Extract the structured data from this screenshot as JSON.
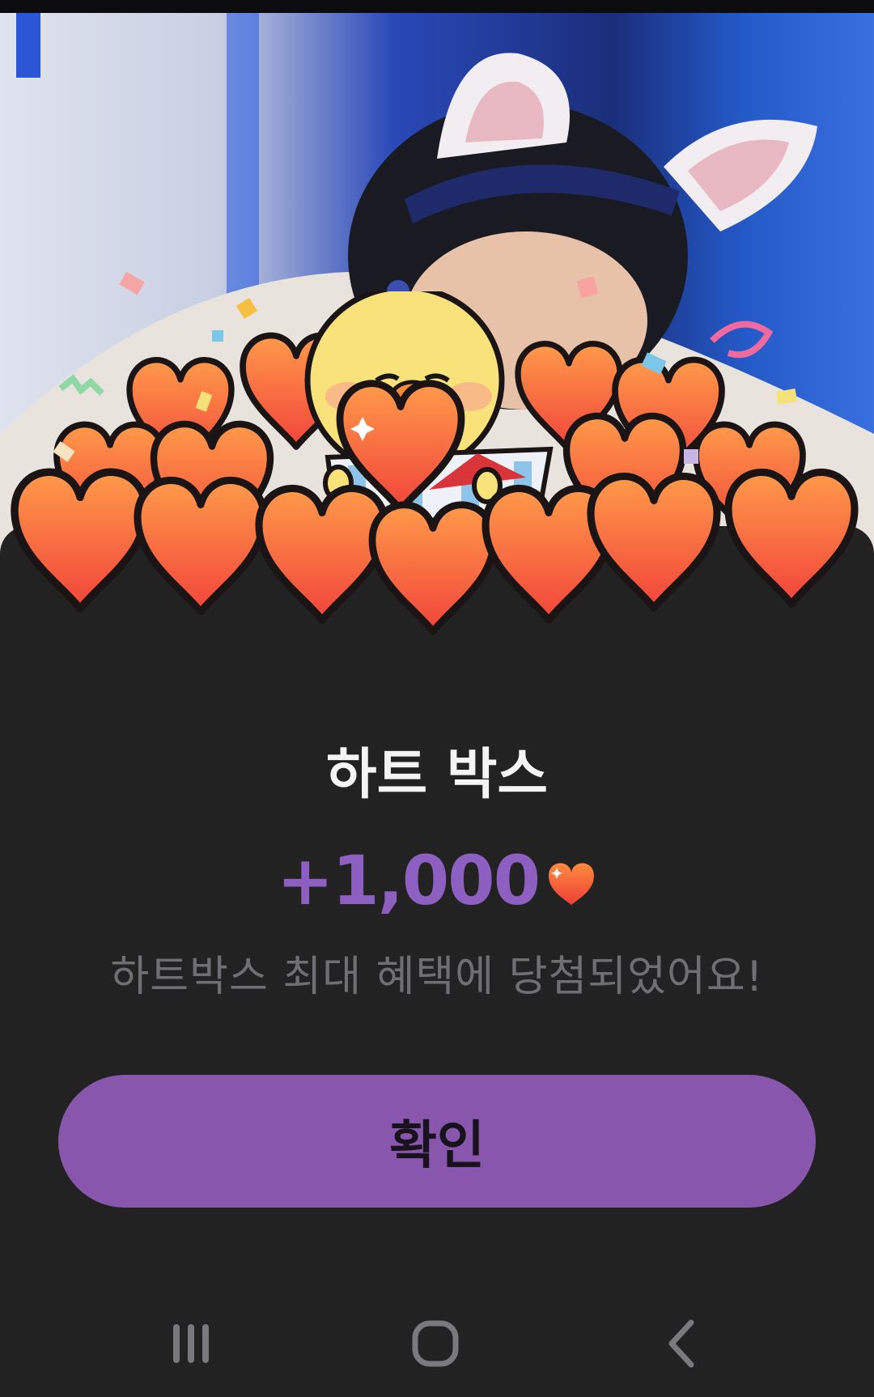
{
  "dialog": {
    "title": "하트 박스",
    "reward_amount": "+1,000",
    "message": "하트박스 최대 혜택에 당첨되었어요!",
    "confirm_label": "확인"
  },
  "colors": {
    "accent": "#8856ad",
    "reward_text": "#8c5fc0",
    "background": "#222223",
    "heart": "#f5573a"
  },
  "icons": {
    "reward": "heart-icon",
    "nav_recents": "recent-apps-icon",
    "nav_home": "home-icon",
    "nav_back": "back-icon"
  }
}
